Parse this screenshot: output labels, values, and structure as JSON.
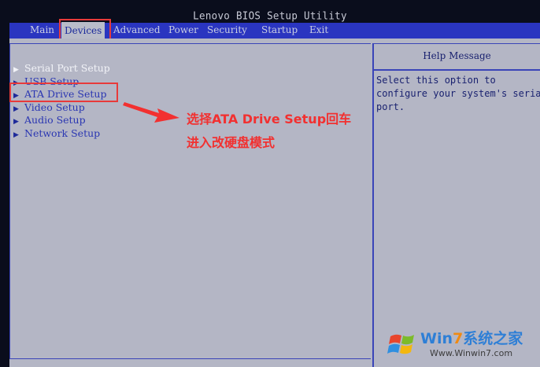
{
  "window": {
    "title": "Lenovo BIOS Setup Utility"
  },
  "menubar": {
    "items": [
      {
        "label": "Main"
      },
      {
        "label": "Devices"
      },
      {
        "label": "Advanced"
      },
      {
        "label": "Power"
      },
      {
        "label": "Security"
      },
      {
        "label": "Startup"
      },
      {
        "label": "Exit"
      }
    ],
    "active": "Devices"
  },
  "devices_menu": {
    "items": [
      {
        "label": "Serial Port Setup"
      },
      {
        "label": "USB Setup"
      },
      {
        "label": "ATA Drive Setup"
      },
      {
        "label": "Video Setup"
      },
      {
        "label": "Audio Setup"
      },
      {
        "label": "Network Setup"
      }
    ]
  },
  "help_panel": {
    "title": "Help Message",
    "text": "Select this option to\nconfigure your system's serial\nport."
  },
  "annotation": {
    "line1": "选择ATA Drive Setup回车",
    "line2": "进入改硬盘模式"
  },
  "watermark": {
    "brand_part1": "Win",
    "brand_part2": "7",
    "brand_part3": "系统之家",
    "url": "Www.Winwin7.com"
  },
  "colors": {
    "menubar_blue": "#2a35c0",
    "panel_gray": "#b4b6c5",
    "annotation_red": "#f23030",
    "highlight_red": "#e83a3a"
  }
}
